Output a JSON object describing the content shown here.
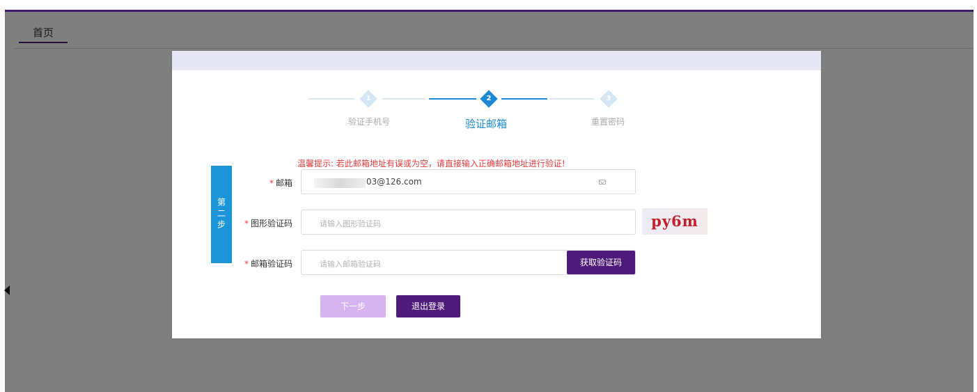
{
  "tabs": {
    "home_label": "首页"
  },
  "steps": [
    {
      "num": "1",
      "label": "验证手机号",
      "state": "done"
    },
    {
      "num": "2",
      "label": "验证邮箱",
      "state": "active"
    },
    {
      "num": "3",
      "label": "重置密码",
      "state": "pending"
    }
  ],
  "hint": "温馨提示: 若此邮箱地址有误或为空，请直接输入正确邮箱地址进行验证!",
  "step_tag": "第二步",
  "form": {
    "required_mark": "*",
    "email_label": "邮箱",
    "email_value": "03@126.com",
    "captcha_label": "图形验证码",
    "captcha_placeholder": "请输入图形验证码",
    "captcha_image_text": "py6m",
    "email_code_label": "邮箱验证码",
    "email_code_placeholder": "请输入邮箱验证码",
    "get_code_button": "获取验证码"
  },
  "buttons": {
    "next": "下一步",
    "logout": "退出登录"
  },
  "colors": {
    "accent": "#4e1b7a",
    "step_active": "#1a8ad6",
    "step_tag": "#1b94d8",
    "warning": "#e53d3d",
    "next_disabled": "#d6b4f0"
  }
}
